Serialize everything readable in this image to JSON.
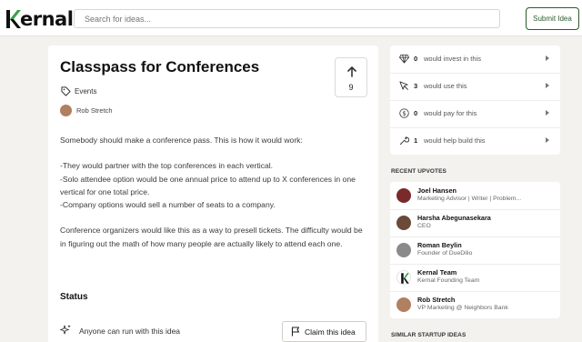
{
  "header": {
    "logo_text": "ernal",
    "search_placeholder": "Search for ideas...",
    "submit_label": "Submit Idea"
  },
  "idea": {
    "title": "Classpass for Conferences",
    "upvote_count": "9",
    "tag": "Events",
    "author": "Rob Stretch",
    "paragraphs": [
      "Somebody should make a conference pass. This is how it would work:",
      "-They would partner with the top conferences in each vertical.\n-Solo attendee option would be one annual price to attend up to X conferences in one vertical for one total price.\n-Company options would sell a number of seats to a company.",
      "Conference organizers would like this as a way to presell tickets. The difficulty would be in figuring out the math of how many people are actually likely to attend each one."
    ],
    "status_title": "Status",
    "status_text": "Anyone can run with this idea",
    "claim_label": "Claim this idea"
  },
  "stats": [
    {
      "icon": "diamond-icon",
      "count": "0",
      "label": "would invest in this"
    },
    {
      "icon": "cursor-icon",
      "count": "3",
      "label": "would use this"
    },
    {
      "icon": "dollar-icon",
      "count": "0",
      "label": "would pay for this"
    },
    {
      "icon": "wrench-icon",
      "count": "1",
      "label": "would help build this"
    }
  ],
  "recent_upvotes": {
    "title": "RECENT UPVOTES",
    "items": [
      {
        "name": "Joel Hansen",
        "role": "Marketing Advisor | Writer | Problem...",
        "avatar_color": "#7a2a2a"
      },
      {
        "name": "Harsha Abegunasekara",
        "role": "CEO",
        "avatar_color": "#6b4a3a"
      },
      {
        "name": "Roman Beylin",
        "role": "Founder of DueDilio",
        "avatar_color": "#8a8a8a"
      },
      {
        "name": "Kernal Team",
        "role": "Kernal Founding Team",
        "avatar_color": "#ffffff"
      },
      {
        "name": "Rob Stretch",
        "role": "VP Marketing @ Neighbors Bank",
        "avatar_color": "#b08060"
      }
    ]
  },
  "similar": {
    "title": "SIMILAR STARTUP IDEAS"
  },
  "colors": {
    "brand_green": "#2b5c2c",
    "logo_green": "#3aa24a",
    "background": "#f4f2ee"
  }
}
